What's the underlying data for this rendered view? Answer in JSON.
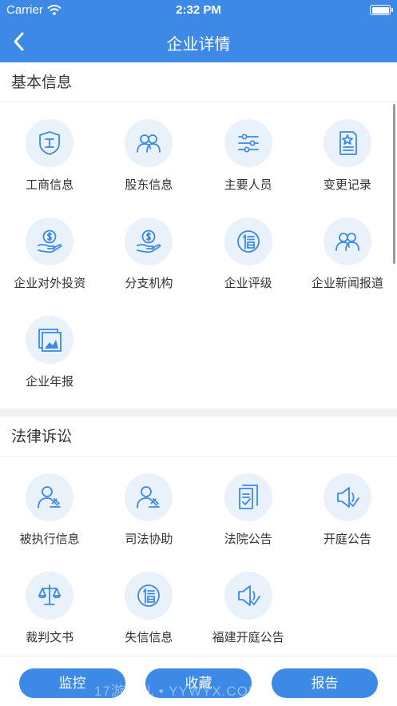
{
  "status_bar": {
    "carrier": "Carrier",
    "time": "2:32 PM"
  },
  "nav": {
    "title": "企业详情"
  },
  "sections": [
    {
      "title": "基本信息",
      "items": [
        {
          "label": "工商信息",
          "icon": "shield-icon"
        },
        {
          "label": "股东信息",
          "icon": "people-icon"
        },
        {
          "label": "主要人员",
          "icon": "sliders-icon"
        },
        {
          "label": "变更记录",
          "icon": "document-star-icon"
        },
        {
          "label": "企业对外投资",
          "icon": "coin-hand-icon"
        },
        {
          "label": "分支机构",
          "icon": "coin-hand-icon"
        },
        {
          "label": "企业评级",
          "icon": "credit-circle-icon"
        },
        {
          "label": "企业新闻报道",
          "icon": "people-icon"
        },
        {
          "label": "企业年报",
          "icon": "picture-frame-icon"
        }
      ]
    },
    {
      "title": "法律诉讼",
      "items": [
        {
          "label": "被执行信息",
          "icon": "person-gavel-icon"
        },
        {
          "label": "司法协助",
          "icon": "person-gavel-icon"
        },
        {
          "label": "法院公告",
          "icon": "document-check-icon"
        },
        {
          "label": "开庭公告",
          "icon": "megaphone-check-icon"
        },
        {
          "label": "裁判文书",
          "icon": "scales-icon"
        },
        {
          "label": "失信信息",
          "icon": "credit-circle-icon"
        },
        {
          "label": "福建开庭公告",
          "icon": "megaphone-check-icon"
        }
      ]
    }
  ],
  "bottom_bar": {
    "monitor_label": "监控",
    "favorite_label": "收藏",
    "report_label": "报告"
  },
  "watermark": "17游意儿 • YYWYX.COM",
  "colors": {
    "primary": "#3d89e6",
    "icon_bg": "#e9f1fb"
  }
}
